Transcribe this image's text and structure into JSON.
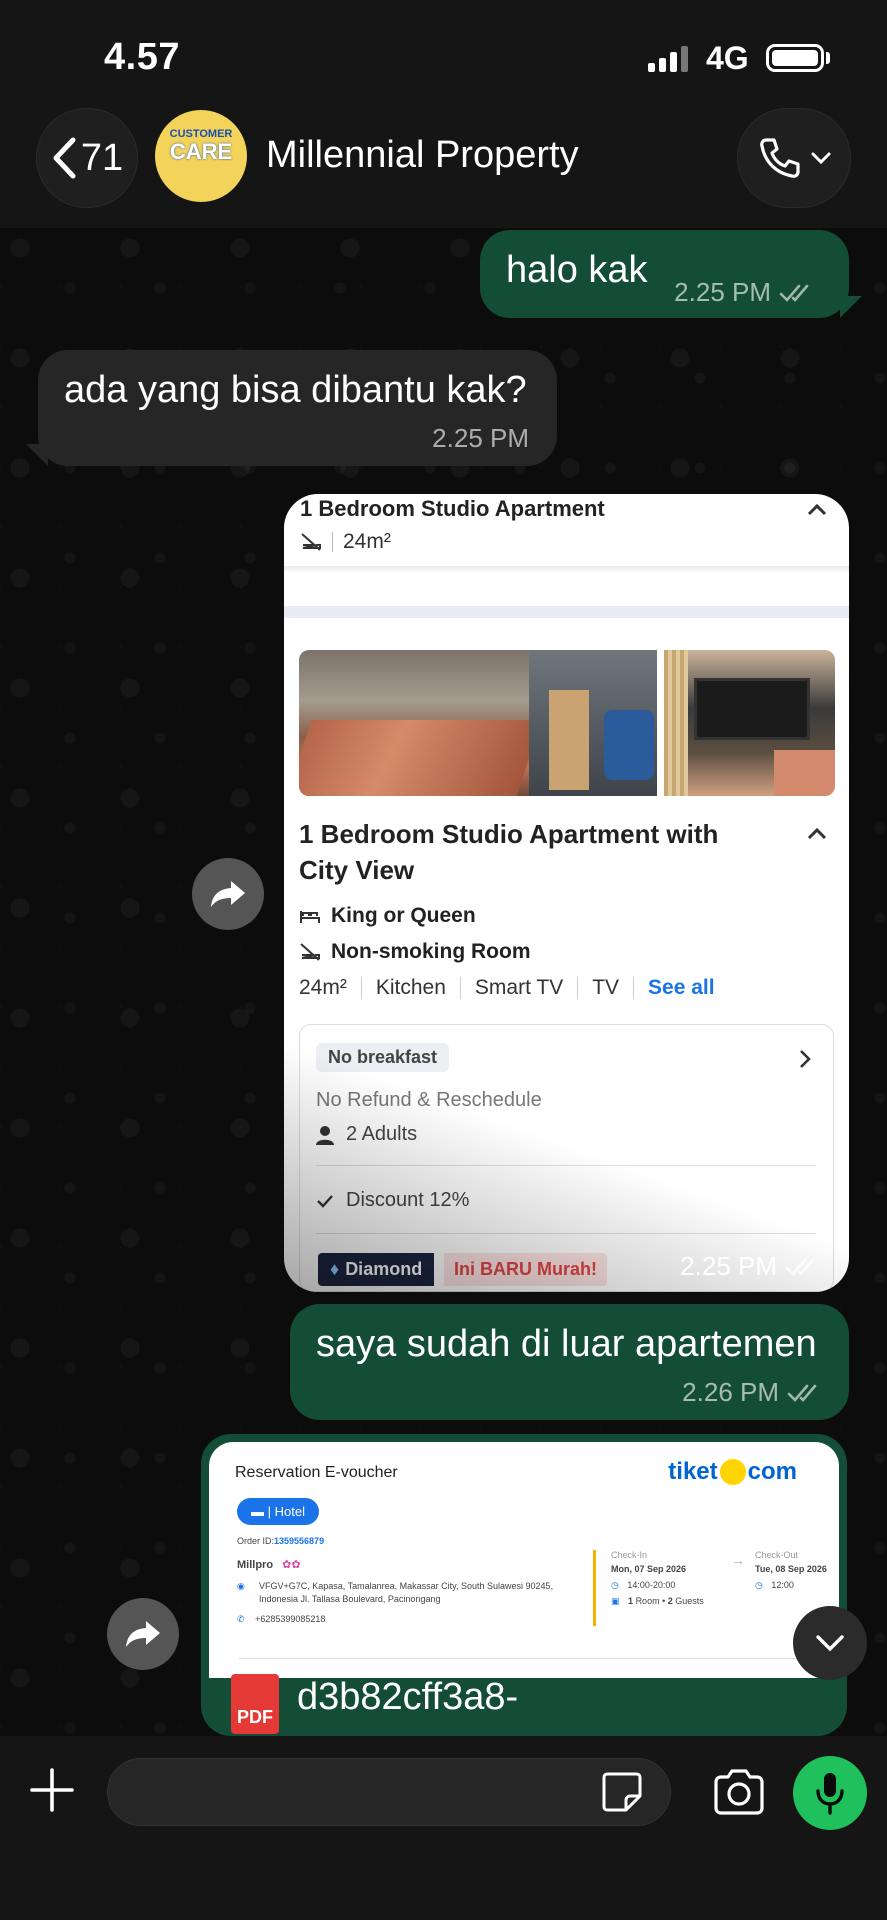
{
  "status_bar": {
    "time": "4.57",
    "network": "4G"
  },
  "header": {
    "back_count": "71",
    "contact_name": "Millennial Property",
    "avatar_text_top": "CUSTOMER",
    "avatar_text_big": "CARE"
  },
  "messages": {
    "m1": {
      "text": "halo kak",
      "time": "2.25 PM"
    },
    "m2": {
      "text": "ada yang bisa dibantu kak?",
      "time": "2.25 PM"
    },
    "image_msg": {
      "time": "2.25 PM",
      "title_top": "1 Bedroom Studio Apartment",
      "size_top": "24m²",
      "room_title": "1 Bedroom Studio Apartment with City View",
      "bed": "King or Queen",
      "smoking": "Non-smoking Room",
      "amenities": [
        "24m²",
        "Kitchen",
        "Smart TV",
        "TV"
      ],
      "see_all": "See all",
      "breakfast": "No breakfast",
      "refund": "No Refund & Reschedule",
      "guests": "2 Adults",
      "discount": "Discount 12%",
      "tier": "Diamond",
      "promo": "Ini BARU Murah!"
    },
    "m3": {
      "text": "saya sudah di luar apartemen",
      "time": "2.26 PM"
    },
    "voucher": {
      "title": "Reservation E-voucher",
      "logo_left": "tiket",
      "logo_right": "com",
      "hotel_label": "Hotel",
      "order_label": "Order ID:",
      "order_id": "1359556879",
      "hotel_name": "Millpro",
      "address": "VFGV+G7C, Kapasa, Tamalanrea, Makassar City, South Sulawesi 90245, Indonesia Jl. Tallasa Boulevard, Pacinongang",
      "phone": "+6285399085218",
      "checkin_label": "Check-In",
      "checkin_date": "Mon, 07 Sep 2026",
      "checkin_time": "14:00-20:00",
      "checkout_label": "Check-Out",
      "checkout_date": "Tue, 08 Sep 2026",
      "checkout_time": "12:00",
      "room_guest_1": "1",
      "room_guest_text1": "Room •",
      "room_guest_2": "2",
      "room_guest_text2": "Guests",
      "pdf_label": "PDF",
      "file_name": "d3b82cff3a8-"
    }
  },
  "composer": {
    "placeholder": ""
  },
  "colors": {
    "outgoing": "#134d37",
    "incoming": "#262626",
    "accent": "#20c05c"
  }
}
